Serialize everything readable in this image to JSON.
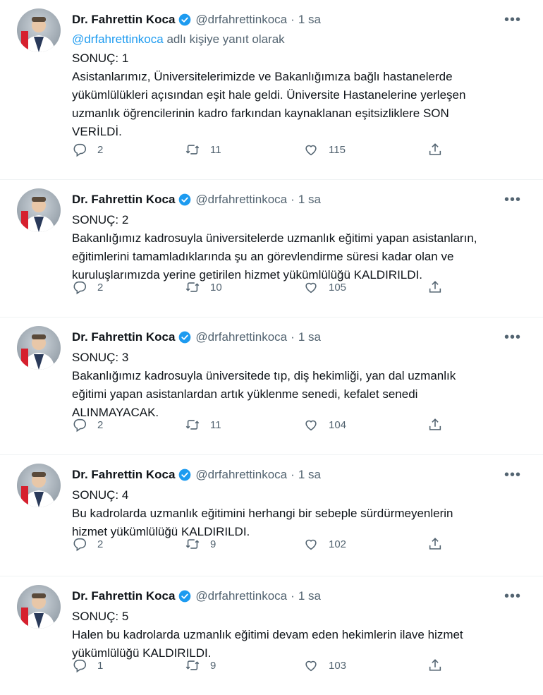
{
  "author": {
    "name": "Dr. Fahrettin Koca",
    "handle": "@drfahrettinkoca",
    "dot": "·",
    "time": "1 sa"
  },
  "reply_to": {
    "mention": "@drfahrettinkoca",
    "suffix": " adlı kişiye yanıt olarak"
  },
  "tweets": [
    {
      "title": "SONUÇ: 1",
      "body": "Asistanlarımız, Üniversitelerimizde ve Bakanlığımıza bağlı hastanelerde\nyükümlülükleri açısından eşit hale geldi. Üniversite Hastanelerine yerleşen\nuzmanlık öğrencilerinin kadro farkından kaynaklanan eşitsizliklere SON\nVERİLDİ.",
      "replies": "2",
      "retweets": "11",
      "likes": "115"
    },
    {
      "title": "SONUÇ: 2",
      "body": "Bakanlığımız kadrosuyla üniversitelerde uzmanlık eğitimi yapan asistanların,\neğitimlerini tamamladıklarında şu an görevlendirme süresi kadar olan ve\nkuruluşlarımızda yerine getirilen hizmet yükümlülüğü KALDIRILDI.",
      "replies": "2",
      "retweets": "10",
      "likes": "105"
    },
    {
      "title": "SONUÇ: 3",
      "body": "Bakanlığımız kadrosuyla üniversitede tıp, diş hekimliği, yan dal uzmanlık\neğitimi yapan asistanlardan artık yüklenme senedi, kefalet senedi\nALINMAYACAK.",
      "replies": "2",
      "retweets": "11",
      "likes": "104"
    },
    {
      "title": "SONUÇ: 4",
      "body": "Bu kadrolarda uzmanlık eğitimini herhangi bir sebeple sürdürmeyenlerin\nhizmet yükümlülüğü KALDIRILDI.",
      "replies": "2",
      "retweets": "9",
      "likes": "102"
    },
    {
      "title": "SONUÇ: 5",
      "body": "Halen bu kadrolarda uzmanlık eğitimi devam eden hekimlerin ilave hizmet\nyükümlülüğü KALDIRILDI.",
      "replies": "1",
      "retweets": "9",
      "likes": "103"
    }
  ],
  "icons": {
    "reply": "reply-icon",
    "retweet": "retweet-icon",
    "like": "like-icon",
    "share": "share-icon",
    "more": "more-icon",
    "verified": "verified-badge-icon"
  },
  "colors": {
    "text": "#0f1419",
    "secondary": "#536471",
    "link": "#1d9bf0"
  }
}
